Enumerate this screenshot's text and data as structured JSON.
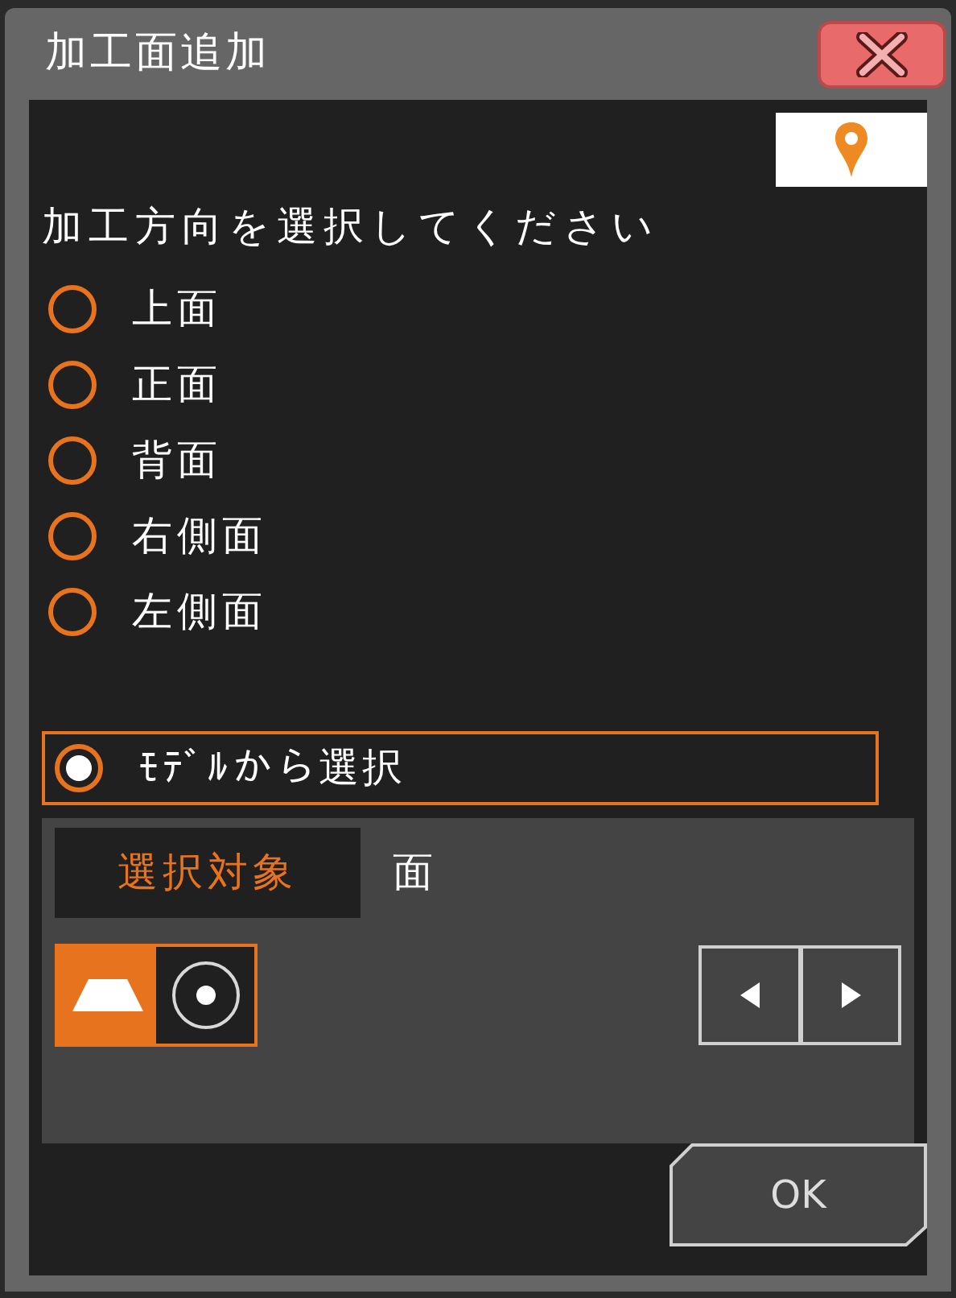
{
  "window": {
    "title": "加工面追加"
  },
  "prompt": "加工方向を選択してください",
  "directions": [
    {
      "label": "上面",
      "selected": false
    },
    {
      "label": "正面",
      "selected": false
    },
    {
      "label": "背面",
      "selected": false
    },
    {
      "label": "右側面",
      "selected": false
    },
    {
      "label": "左側面",
      "selected": false
    }
  ],
  "model_select": {
    "label": "ﾓﾃﾞﾙから選択",
    "selected": true
  },
  "selection_target": {
    "label": "選択対象",
    "value": "面"
  },
  "mode_buttons": [
    {
      "kind": "face",
      "selected": true
    },
    {
      "kind": "point",
      "selected": false
    }
  ],
  "ok_button": "OK"
}
